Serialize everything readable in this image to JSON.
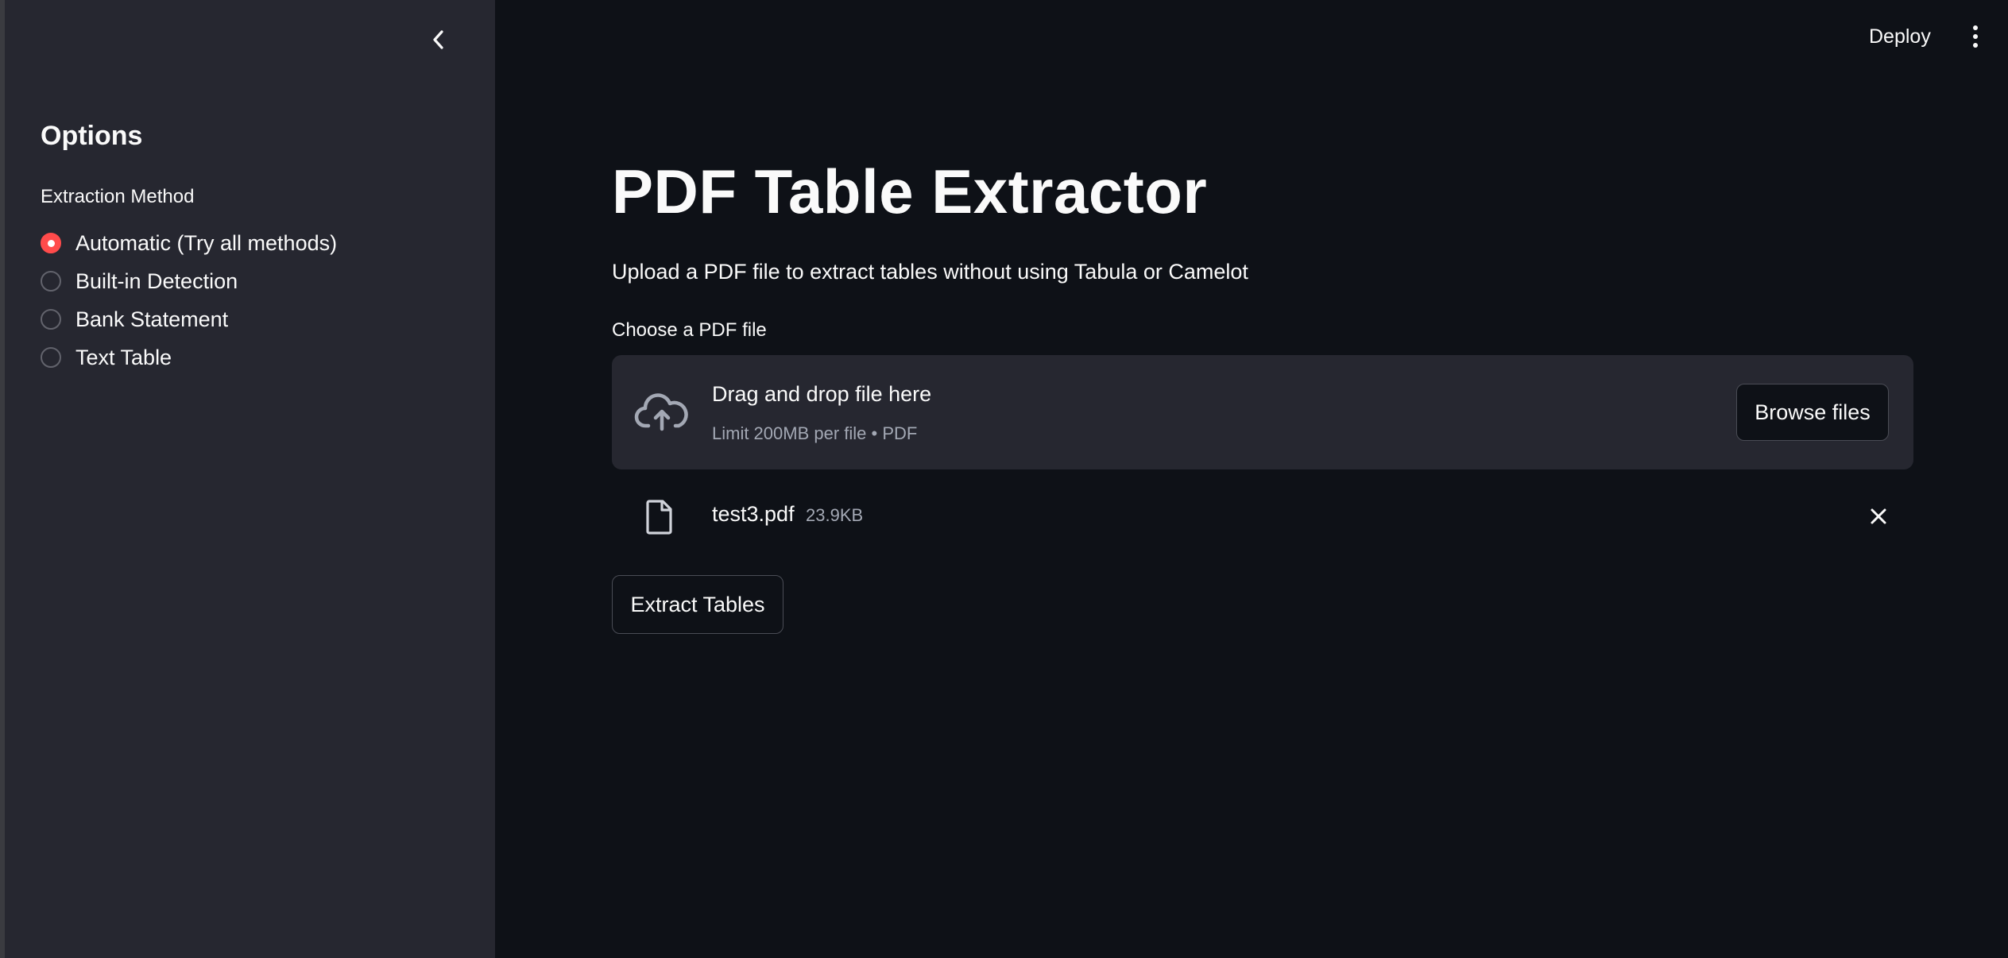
{
  "sidebar": {
    "title": "Options",
    "radio_group_label": "Extraction Method",
    "options": [
      {
        "label": "Automatic (Try all methods)",
        "selected": true
      },
      {
        "label": "Built-in Detection",
        "selected": false
      },
      {
        "label": "Bank Statement",
        "selected": false
      },
      {
        "label": "Text Table",
        "selected": false
      }
    ]
  },
  "header": {
    "deploy_label": "Deploy"
  },
  "main": {
    "title": "PDF Table Extractor",
    "subtitle": "Upload a PDF file to extract tables without using Tabula or Camelot",
    "uploader": {
      "label": "Choose a PDF file",
      "drop_title": "Drag and drop file here",
      "drop_limit": "Limit 200MB per file • PDF",
      "browse_label": "Browse files"
    },
    "file": {
      "name": "test3.pdf",
      "size": "23.9KB"
    },
    "extract_label": "Extract Tables"
  },
  "colors": {
    "background": "#0e1117",
    "sidebar": "#262730",
    "accent": "#ff4b4b",
    "text": "#fafafa",
    "muted": "#a3a8b4"
  },
  "icons": [
    "chevron-left-icon",
    "kebab-menu-icon",
    "cloud-upload-icon",
    "file-icon",
    "close-icon"
  ]
}
